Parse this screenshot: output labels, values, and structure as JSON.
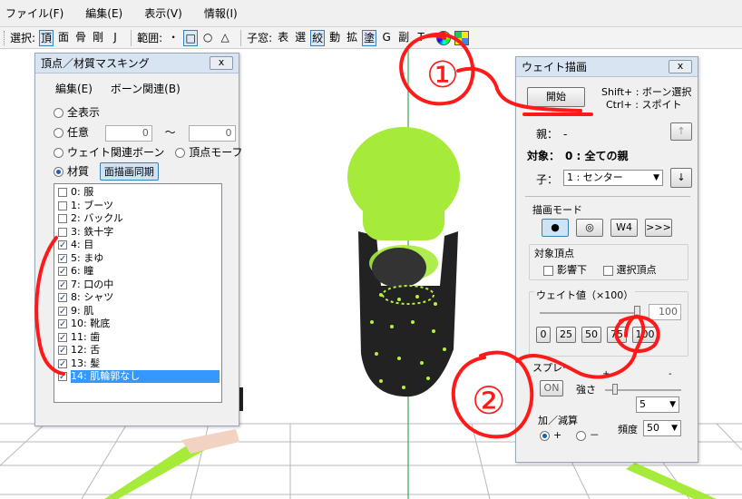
{
  "menubar": {
    "items": [
      "ファイル(F)",
      "編集(E)",
      "表示(V)",
      "情報(I)"
    ]
  },
  "toolbar": {
    "select_label": "選択:",
    "select_items": [
      {
        "label": "頂",
        "on": true
      },
      {
        "label": "面",
        "on": false
      },
      {
        "label": "骨",
        "on": false
      },
      {
        "label": "剛",
        "on": false
      },
      {
        "label": "J",
        "on": false
      }
    ],
    "range_label": "範囲:",
    "range_items": [
      {
        "label": "・",
        "on": false
      },
      {
        "label": "□",
        "on": true
      },
      {
        "label": "○",
        "on": false
      },
      {
        "label": "△",
        "on": false
      }
    ],
    "window_label": "子窓:",
    "window_items": [
      {
        "label": "表",
        "on": false
      },
      {
        "label": "選",
        "on": false
      },
      {
        "label": "絞",
        "on": true
      },
      {
        "label": "動",
        "on": false
      },
      {
        "label": "拡",
        "on": false
      },
      {
        "label": "塗",
        "on": true
      },
      {
        "label": "G",
        "on": false
      },
      {
        "label": "副",
        "on": false
      },
      {
        "label": "T",
        "on": false
      }
    ]
  },
  "masking": {
    "title": "頂点／材質マスキング",
    "close": "ⅹ",
    "menu_edit": "編集(E)",
    "menu_bone": "ボーン関連(B)",
    "opt_all": "全表示",
    "opt_any": "任意",
    "any_from": "0",
    "any_tilde": "～",
    "any_to": "0",
    "opt_weight_bone": "ウェイト関連ボーン",
    "opt_morph": "頂点モーフ",
    "opt_material": "材質",
    "sync_button": "面描画同期",
    "materials": [
      {
        "label": "0: 服",
        "checked": false
      },
      {
        "label": "1: ブーツ",
        "checked": false
      },
      {
        "label": "2: バックル",
        "checked": false
      },
      {
        "label": "3: 鉄十字",
        "checked": false
      },
      {
        "label": "4: 目",
        "checked": true
      },
      {
        "label": "5: まゆ",
        "checked": true
      },
      {
        "label": "6: 瞳",
        "checked": true
      },
      {
        "label": "7: 口の中",
        "checked": true
      },
      {
        "label": "8: シャツ",
        "checked": true
      },
      {
        "label": "9: 肌",
        "checked": true
      },
      {
        "label": "10: 靴底",
        "checked": true
      },
      {
        "label": "11: 歯",
        "checked": true
      },
      {
        "label": "12: 舌",
        "checked": true
      },
      {
        "label": "13: 髪",
        "checked": true
      },
      {
        "label": "14: 肌輪郭なし",
        "checked": true,
        "selected": true
      }
    ]
  },
  "weight": {
    "title": "ウェイト描画",
    "close": "ⅹ",
    "start_button": "開始",
    "hint1": "Shift+ : ボーン選択",
    "hint2": "Ctrl+ : スポイト",
    "parent_label": "親：",
    "parent_value": "-",
    "up_arrow": "↑",
    "target_label": "対象：",
    "target_value": "0 : 全ての親",
    "child_label": "子：",
    "child_value": "1 : センター",
    "down_arrow": "↓",
    "mode_label": "描画モード",
    "mode_buttons": [
      "●",
      "◎",
      "W4",
      ">>>"
    ],
    "target_vertex_label": "対象頂点",
    "influence_label": "影響下",
    "selected_vertex_label": "選択頂点",
    "weight_value_label": "ウェイト値（×100）",
    "weight_value": "100",
    "slider_value": 100,
    "preset_buttons": [
      "0",
      "25",
      "50",
      "75",
      "100"
    ],
    "spray_label": "スプレー",
    "spray_plus": "+",
    "spray_minus": "-",
    "spray_btn": "ON",
    "strength_label": "強さ",
    "strength_value": "5",
    "add_sub_label": "加／減算",
    "add_label": "+",
    "sub_label": "－",
    "freq_label": "頻度",
    "freq_value": "50"
  },
  "annotations": {
    "circle1": "①",
    "circle2": "②"
  }
}
